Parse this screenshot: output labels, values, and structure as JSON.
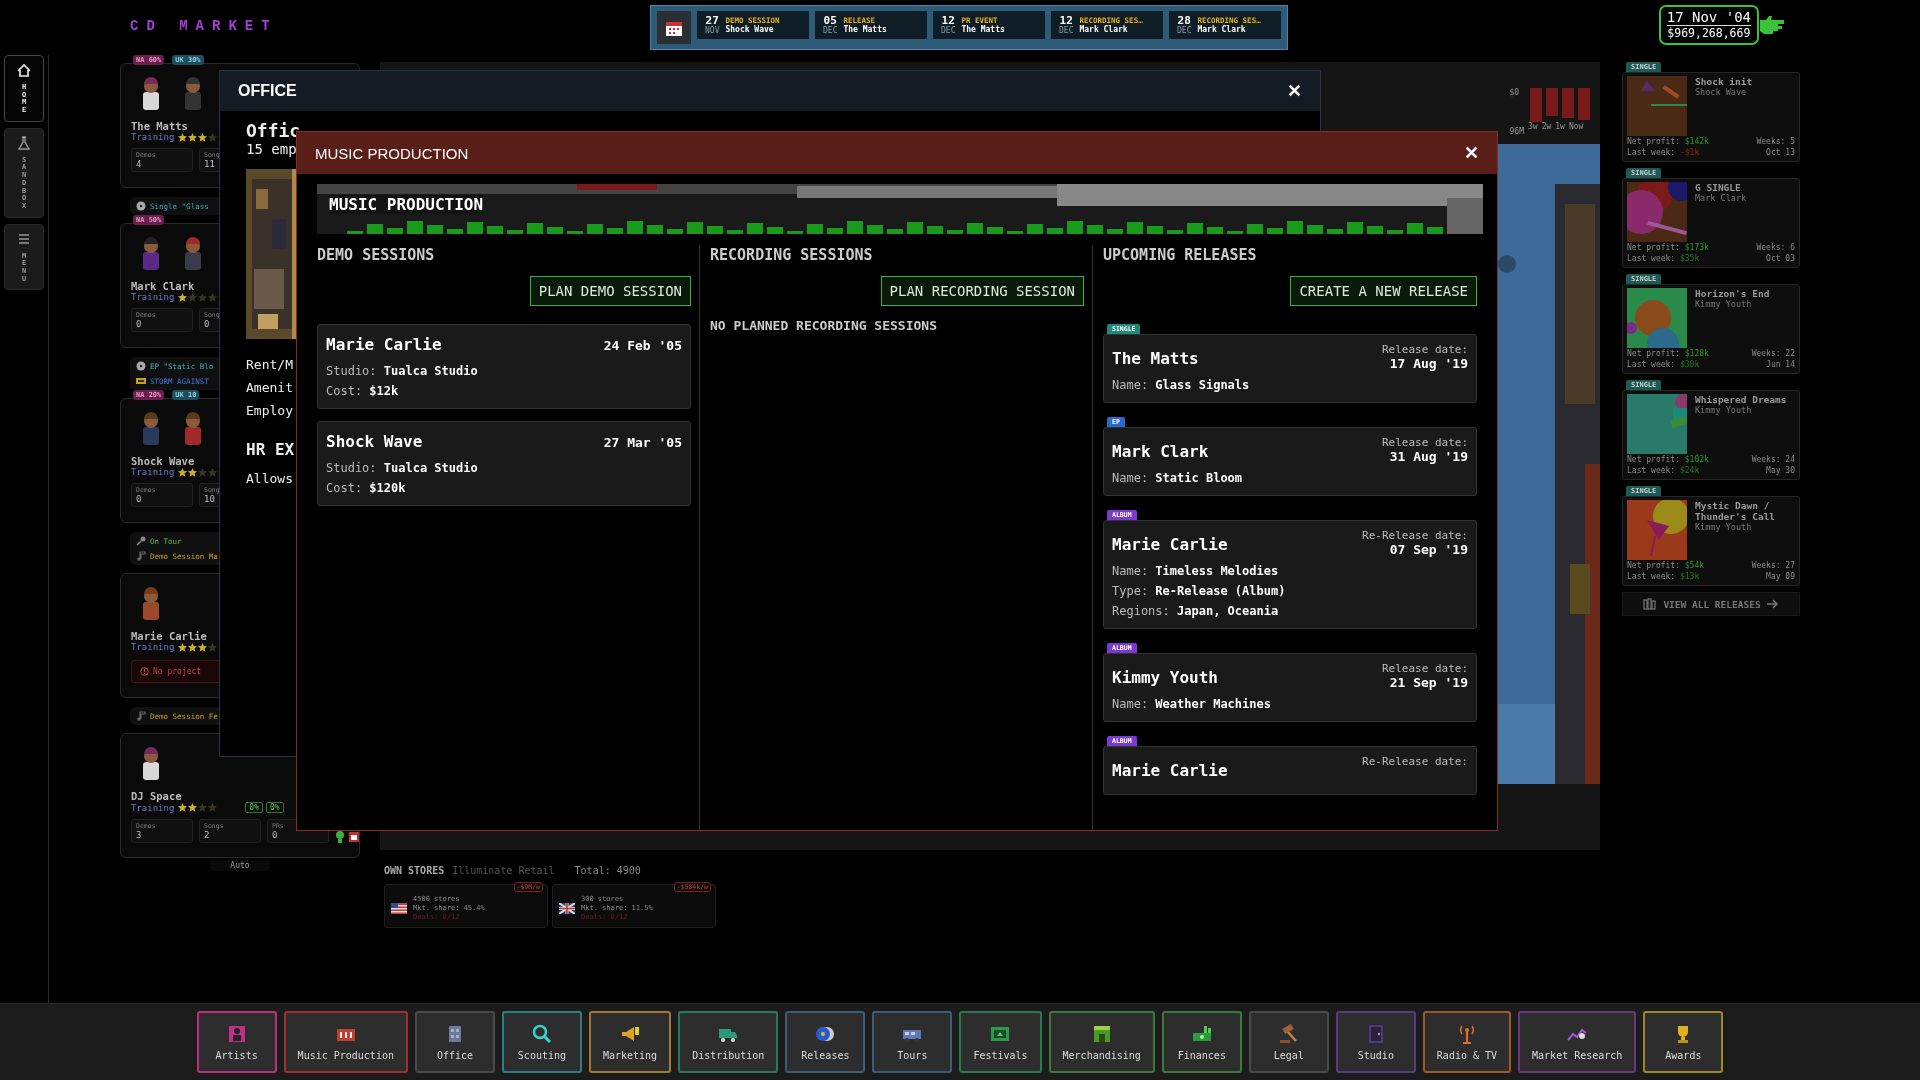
{
  "logo": "CD MARKET",
  "events": [
    {
      "day": "27",
      "month": "NOV",
      "type": "DEMO SESSION",
      "artist": "Shock Wave"
    },
    {
      "day": "05",
      "month": "DEC",
      "type": "RELEASE",
      "artist": "The Matts"
    },
    {
      "day": "12",
      "month": "DEC",
      "type": "PR EVENT",
      "artist": "The Matts"
    },
    {
      "day": "12",
      "month": "DEC",
      "type": "RECORDING SES…",
      "artist": "Mark Clark"
    },
    {
      "day": "28",
      "month": "DEC",
      "type": "RECORDING SES…",
      "artist": "Mark Clark"
    }
  ],
  "clock": {
    "date": "17 Nov '04",
    "money": "$969,268,669"
  },
  "nav": [
    {
      "label": "HOME",
      "kind": "home",
      "selected": true
    },
    {
      "label": "SANDBOX",
      "kind": "sandbox",
      "selected": false
    },
    {
      "label": "MENU",
      "kind": "menu",
      "selected": false
    }
  ],
  "artists": [
    {
      "name": "The Matts",
      "kind": "duo",
      "training": "Training",
      "stars": 3,
      "badges": [
        {
          "text": "NA 60%",
          "kind": "na"
        },
        {
          "text": "UK 30%",
          "kind": "uk"
        }
      ],
      "stats": [
        {
          "label": "Demos",
          "value": "4"
        },
        {
          "label": "Song",
          "value": "11"
        }
      ],
      "activities": [
        {
          "kind": "release",
          "text": "Single \"Glass"
        }
      ]
    },
    {
      "name": "Mark Clark",
      "kind": "duo",
      "training": "Training",
      "stars": 1,
      "badges": [
        {
          "text": "NA 50%",
          "kind": "na"
        }
      ],
      "stats": [
        {
          "label": "Demos",
          "value": "0"
        },
        {
          "label": "Song",
          "value": "0"
        }
      ],
      "activities": [
        {
          "kind": "release",
          "text": "EP \"Static Blo"
        },
        {
          "kind": "promo",
          "text": "STORM AGAINST"
        }
      ]
    },
    {
      "name": "Shock Wave",
      "kind": "duo",
      "training": "Training",
      "stars": 2,
      "badges": [
        {
          "text": "NA 20%",
          "kind": "na"
        },
        {
          "text": "UK 10",
          "kind": "uk"
        }
      ],
      "stats": [
        {
          "label": "Demos",
          "value": "0"
        },
        {
          "label": "Song",
          "value": "10"
        }
      ],
      "activities": [
        {
          "kind": "tour",
          "text": "On Tour"
        },
        {
          "kind": "session",
          "text": "Demo Session Ma"
        }
      ]
    },
    {
      "name": "Marie Carlie",
      "kind": "solo",
      "training": "Training",
      "stars": 3,
      "warning": "No project",
      "activities": [
        {
          "kind": "session",
          "text": "Demo Session Fe"
        }
      ]
    },
    {
      "name": "DJ Space",
      "kind": "solo",
      "training": "Training",
      "stars": 2,
      "rates": [
        "0%",
        "0%"
      ],
      "stats": [
        {
          "label": "Demos",
          "value": "3"
        },
        {
          "label": "Songs",
          "value": "2"
        },
        {
          "label": "PRs",
          "value": "0"
        }
      ],
      "footer": "Auto"
    }
  ],
  "market": {
    "chart_labels": {
      "top": "$0",
      "side": "96M",
      "x": [
        "3w",
        "2w",
        "1w",
        "Now"
      ]
    },
    "stores": {
      "title": "OWN STORES",
      "company": "Illuminate Retail",
      "total": "Total: 4900",
      "items": [
        {
          "count": "4500 stores",
          "share": "Mkt. share: 45.4%",
          "deals": "Deals: 0/12",
          "cost": "-$9M/w"
        },
        {
          "count": "300 stores",
          "share": "Mkt. share: 11.5%",
          "deals": "Deals: 0/12",
          "cost": "-$584k/w"
        }
      ]
    }
  },
  "office": {
    "title": "OFFICE",
    "close": "✕",
    "heading": "Offic",
    "subheading": "15 emp",
    "lines": [
      "Rent/M",
      "Amenit",
      "Employ"
    ],
    "section": "HR EX",
    "section_text": "Allows"
  },
  "music_production": {
    "title": "MUSIC PRODUCTION",
    "close": "✕",
    "banner": "MUSIC PRODUCTION",
    "demo": {
      "title": "DEMO SESSIONS",
      "button": "PLAN DEMO SESSION",
      "sessions": [
        {
          "artist": "Marie Carlie",
          "date": "24 Feb '05",
          "fields": [
            "Studio: **Tualca Studio**",
            "Cost: **$12k**"
          ]
        },
        {
          "artist": "Shock Wave",
          "date": "27 Mar '05",
          "fields": [
            "Studio: **Tualca Studio**",
            "Cost: **$120k**"
          ]
        }
      ]
    },
    "recording": {
      "title": "RECORDING SESSIONS",
      "button": "PLAN RECORDING SESSION",
      "empty": "NO PLANNED RECORDING SESSIONS"
    },
    "upcoming": {
      "title": "UPCOMING RELEASES",
      "button": "CREATE A NEW RELEASE",
      "releases": [
        {
          "type": "SINGLE",
          "artist": "The Matts",
          "date_label": "Release date:",
          "date": "17 Aug '19",
          "fields": [
            "Name: **Glass Signals**"
          ]
        },
        {
          "type": "EP",
          "artist": "Mark Clark",
          "date_label": "Release date:",
          "date": "31 Aug '19",
          "fields": [
            "Name: **Static Bloom**"
          ]
        },
        {
          "type": "ALBUM",
          "artist": "Marie Carlie",
          "date_label": "Re-Release date:",
          "date": "07 Sep '19",
          "fields": [
            "Name: **Timeless Melodies**",
            "Type: **Re-Release (Album)**",
            "Regions: **Japan, Oceania**"
          ]
        },
        {
          "type": "ALBUM",
          "artist": "Kimmy Youth",
          "date_label": "Release date:",
          "date": "21 Sep '19",
          "fields": [
            "Name: **Weather Machines**"
          ]
        },
        {
          "type": "ALBUM",
          "artist": "Marie Carlie",
          "date_label": "Re-Release date:"
        }
      ]
    }
  },
  "recent_releases": {
    "items": [
      {
        "type": "SINGLE",
        "title": "Shock init",
        "artist": "Shock Wave",
        "profit_label": "Net profit:",
        "profit": "$142k",
        "weeks": "Weeks: 5",
        "last_label": "Last week:",
        "last": "-$1k",
        "negative": true,
        "date": "Oct 13"
      },
      {
        "type": "SINGLE",
        "title": "G SINGLE",
        "artist": "Mark Clark",
        "profit_label": "Net profit:",
        "profit": "$173k",
        "weeks": "Weeks: 6",
        "last_label": "Last week:",
        "last": "$35k",
        "negative": false,
        "date": "Oct 03"
      },
      {
        "type": "SINGLE",
        "title": "Horizon's End",
        "artist": "Kimmy Youth",
        "profit_label": "Net profit:",
        "profit": "$128k",
        "weeks": "Weeks: 22",
        "last_label": "Last week:",
        "last": "$30k",
        "negative": false,
        "date": "Jun 14"
      },
      {
        "type": "SINGLE",
        "title": "Whispered Dreams",
        "artist": "Kimmy Youth",
        "profit_label": "Net profit:",
        "profit": "$102k",
        "weeks": "Weeks: 24",
        "last_label": "Last week:",
        "last": "$24k",
        "negative": false,
        "date": "May 30"
      },
      {
        "type": "SINGLE",
        "title": "Mystic Dawn / Thunder's Call",
        "artist": "Kimmy Youth",
        "profit_label": "Net profit:",
        "profit": "$54k",
        "weeks": "Weeks: 27",
        "last_label": "Last week:",
        "last": "$13k",
        "negative": false,
        "date": "May 09"
      }
    ],
    "view_all": "VIEW ALL RELEASES"
  },
  "toolbar": [
    {
      "label": "Artists",
      "color": "#b8307e"
    },
    {
      "label": "Music Production",
      "color": "#a0302c"
    },
    {
      "label": "Office",
      "color": "#4a4a4a"
    },
    {
      "label": "Scouting",
      "color": "#2a8080"
    },
    {
      "label": "Marketing",
      "color": "#a07a30"
    },
    {
      "label": "Distribution",
      "color": "#2a7a5c"
    },
    {
      "label": "Releases",
      "color": "#3a5e7a"
    },
    {
      "label": "Tours",
      "color": "#3a5a7e"
    },
    {
      "label": "Festivals",
      "color": "#2a7a4e"
    },
    {
      "label": "Merchandising",
      "color": "#3a7a3a"
    },
    {
      "label": "Finances",
      "color": "#3a7a40"
    },
    {
      "label": "Legal",
      "color": "#4a4a4a"
    },
    {
      "label": "Studio",
      "color": "#5a3a82"
    },
    {
      "label": "Radio & TV",
      "color": "#a0582a"
    },
    {
      "label": "Market Research",
      "color": "#6a3a78"
    },
    {
      "label": "Awards",
      "color": "#a0882a"
    }
  ]
}
